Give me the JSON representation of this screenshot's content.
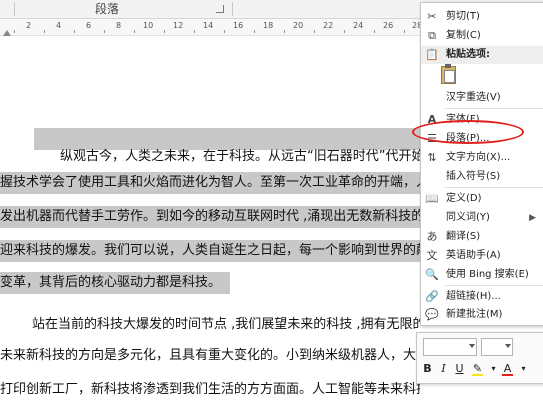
{
  "ribbon": {
    "group_label": "段落"
  },
  "ruler": {
    "numbers": [
      "2",
      "4",
      "6",
      "8",
      "10",
      "12",
      "14",
      "16",
      "18",
      "20",
      "22",
      "24",
      "26",
      "28"
    ]
  },
  "document": {
    "lines": [
      "纵观古今，人类之未来，在于科技。从远古“旧石器时代”代开始，猿人",
      "握技术学会了使用工具和火焰而进化为智人。至第一次工业革命的开端，人类",
      "发出机器而代替手工劳作。到如今的移动互联网时代 ,涌现出无数新科技的火",
      "迎来科技的爆发。我们可以说，人类自诞生之日起，每一个影响到世界的颠覆",
      "变革，其背后的核心驱动力都是科技。",
      "站在当前的科技大爆发的时间节点 ,我们展望未来的科技 ,拥有无限的可能。",
      "未来新科技的方向是多元化，且具有重大变化的。小到纳米级机器人，大到",
      "打印创新工厂，新科技将渗透到我们生活的方方面面。人工智能等未来科技将深"
    ]
  },
  "context_menu": {
    "cut": "剪切(T)",
    "copy": "复制(C)",
    "paste_options": "粘贴选项:",
    "reconvert": "汉字重选(V)",
    "font": "字体(F)...",
    "paragraph": "段落(P)...",
    "text_direction": "文字方向(X)...",
    "insert_symbol": "插入符号(S)",
    "define": "定义(D)",
    "synonyms": "同义词(Y)",
    "translate": "翻译(S)",
    "english_assistant": "英语助手(A)",
    "bing_search": "使用 Bing 搜索(E)",
    "hyperlink": "超链接(H)...",
    "new_comment": "新建批注(M)"
  },
  "mini_toolbar": {
    "bold": "B",
    "italic": "I",
    "underline": "U",
    "font_color_letter": "A",
    "highlight_color": "#f5e51b",
    "font_color": "#e3201b"
  },
  "colors": {
    "selection": "#c8c8c8",
    "annotation_red": "#e3201b"
  }
}
